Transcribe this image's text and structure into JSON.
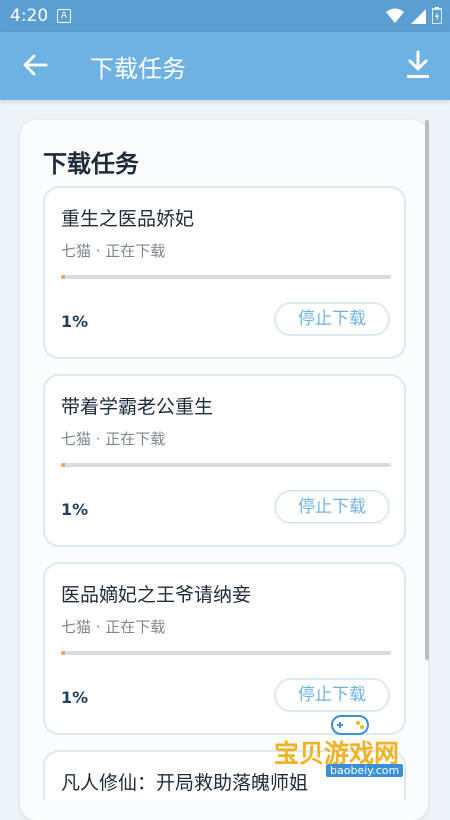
{
  "status_bar": {
    "time": "4:20",
    "notification_badge": "A",
    "icons": [
      "wifi-icon",
      "signal-icon",
      "battery-icon"
    ]
  },
  "app_bar": {
    "title": "下载任务",
    "back_icon": "arrow-left-icon",
    "download_icon": "download-icon"
  },
  "panel": {
    "heading": "下载任务"
  },
  "tasks": [
    {
      "name": "重生之医品娇妃",
      "meta": "七猫 · 正在下载",
      "progress_percent": 1,
      "progress_label": "1%",
      "stop_label": "停止下载"
    },
    {
      "name": "带着学霸老公重生",
      "meta": "七猫 · 正在下载",
      "progress_percent": 1,
      "progress_label": "1%",
      "stop_label": "停止下载"
    },
    {
      "name": "医品嫡妃之王爷请纳妾",
      "meta": "七猫 · 正在下载",
      "progress_percent": 1,
      "progress_label": "1%",
      "stop_label": "停止下载"
    },
    {
      "name": "凡人修仙：开局救助落魄师姐",
      "meta": "",
      "progress_percent": null,
      "progress_label": "",
      "stop_label": ""
    }
  ],
  "watermark": {
    "text": "宝贝游戏网",
    "domain": "baobeiy.com"
  },
  "colors": {
    "app_bar": "#6eb2e4",
    "status_bar": "#5a9fd2",
    "progress_fill": "#f2a65a",
    "accent_text": "#6eb2e4"
  }
}
